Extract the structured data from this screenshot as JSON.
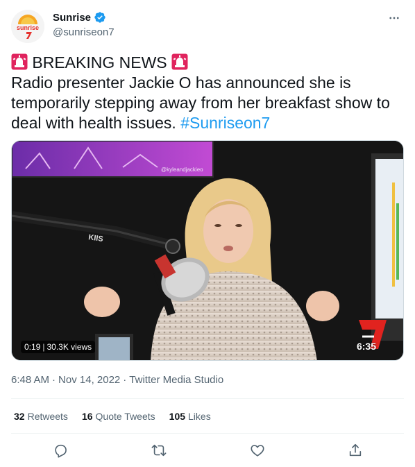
{
  "account": {
    "display_name": "Sunrise",
    "handle": "@sunriseon7",
    "avatar_text": "sunrise"
  },
  "tweet": {
    "headline": "BREAKING NEWS",
    "line1": "Radio presenter Jackie O has announced she is",
    "line2": "temporarily stepping away from her breakfast show to",
    "line3": "deal with health issues.",
    "hashtag": "#Sunriseon7"
  },
  "media": {
    "time_badge": "0:19",
    "views": "30.3K views",
    "overlay_time": "6:35",
    "mic_label": "KIIS",
    "watermark": "@kyleandjackieo"
  },
  "meta": {
    "time": "6:48 AM",
    "date": "Nov 14, 2022",
    "separator": "·",
    "source": "Twitter Media Studio"
  },
  "stats": {
    "retweets_count": "32",
    "retweets_label": "Retweets",
    "quotes_count": "16",
    "quotes_label": "Quote Tweets",
    "likes_count": "105",
    "likes_label": "Likes"
  },
  "icons": {
    "more": "more-icon",
    "verified": "verified-icon",
    "reply": "reply-icon",
    "retweet": "retweet-icon",
    "like": "like-icon",
    "share": "share-icon",
    "siren": "siren-icon"
  },
  "colors": {
    "link": "#1d9bf0",
    "secondary": "#536471",
    "siren": "#e0245e"
  }
}
